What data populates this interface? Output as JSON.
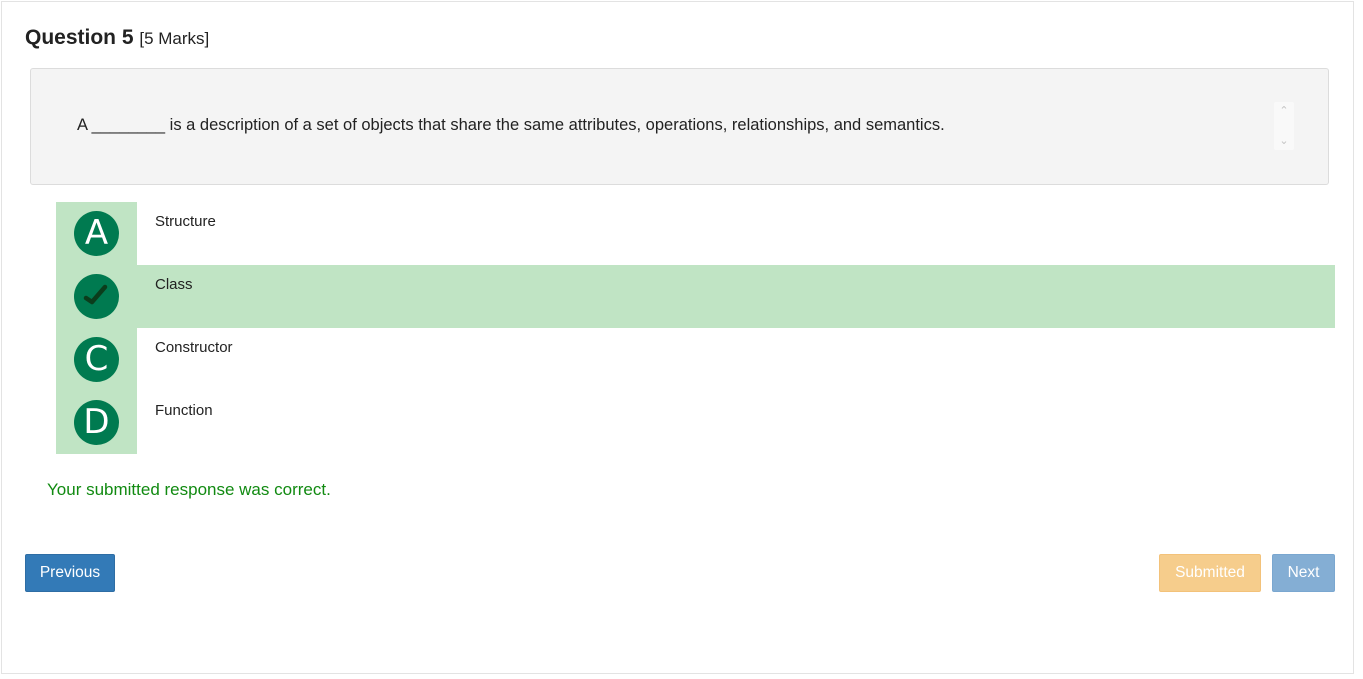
{
  "question": {
    "title": "Question 5",
    "marks": "[5 Marks]",
    "text": "A ________ is a description of a set of objects that share the same attributes, operations, relationships, and semantics."
  },
  "options": [
    {
      "letter": "A",
      "label": "Structure",
      "selected": false
    },
    {
      "letter": "B",
      "label": "Class",
      "selected": true,
      "icon": "checkmark-icon"
    },
    {
      "letter": "C",
      "label": "Constructor",
      "selected": false
    },
    {
      "letter": "D",
      "label": "Function",
      "selected": false
    }
  ],
  "feedback": "Your submitted response was correct.",
  "buttons": {
    "previous": "Previous",
    "submitted": "Submitted",
    "next": "Next"
  },
  "colors": {
    "badge": "#007a50",
    "selected_row": "#c0e4c4",
    "correct_text": "#118a11",
    "previous_button": "#337ab7",
    "submitted_button": "#f6cd8c",
    "next_button": "#84aed4"
  }
}
